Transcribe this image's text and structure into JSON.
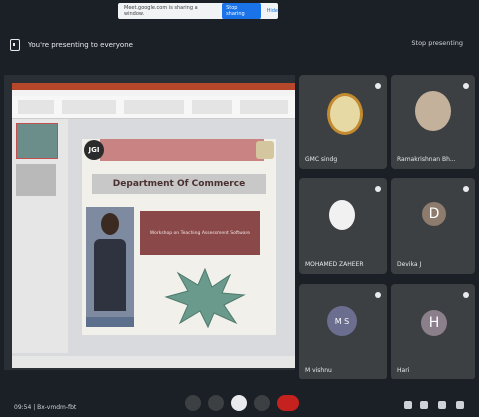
{
  "share_bar": {
    "message": "Meet.google.com is sharing a window.",
    "stop_label": "Stop sharing",
    "hide_label": "Hide"
  },
  "header": {
    "presenting_text": "You're presenting to everyone",
    "stop_presenting_label": "Stop presenting"
  },
  "slide": {
    "logo_text": "JGI",
    "department_title": "Department Of Commerce",
    "topic_text": "Workshop on Teaching Assessment Software"
  },
  "participants": [
    {
      "name": "GMC sindg",
      "type": "emblem"
    },
    {
      "name": "Ramakrishnan Bh...",
      "type": "portrait"
    },
    {
      "name": "MOHAMED ZAHEER",
      "type": "portrait"
    },
    {
      "name": "Devika J",
      "type": "initial",
      "initial": "D",
      "color": "#8d7b6e"
    },
    {
      "name": "M vishnu",
      "type": "initial",
      "initial": "M S",
      "color": "#6b6e8e"
    },
    {
      "name": "Hari",
      "type": "initial",
      "initial": "H",
      "color": "#8a7f8a"
    }
  ],
  "bottom": {
    "meeting_info": "09:54 | Bx-vmdm-fbt"
  },
  "colors": {
    "accent": "#1a73e8",
    "end_call": "#c5221f"
  }
}
